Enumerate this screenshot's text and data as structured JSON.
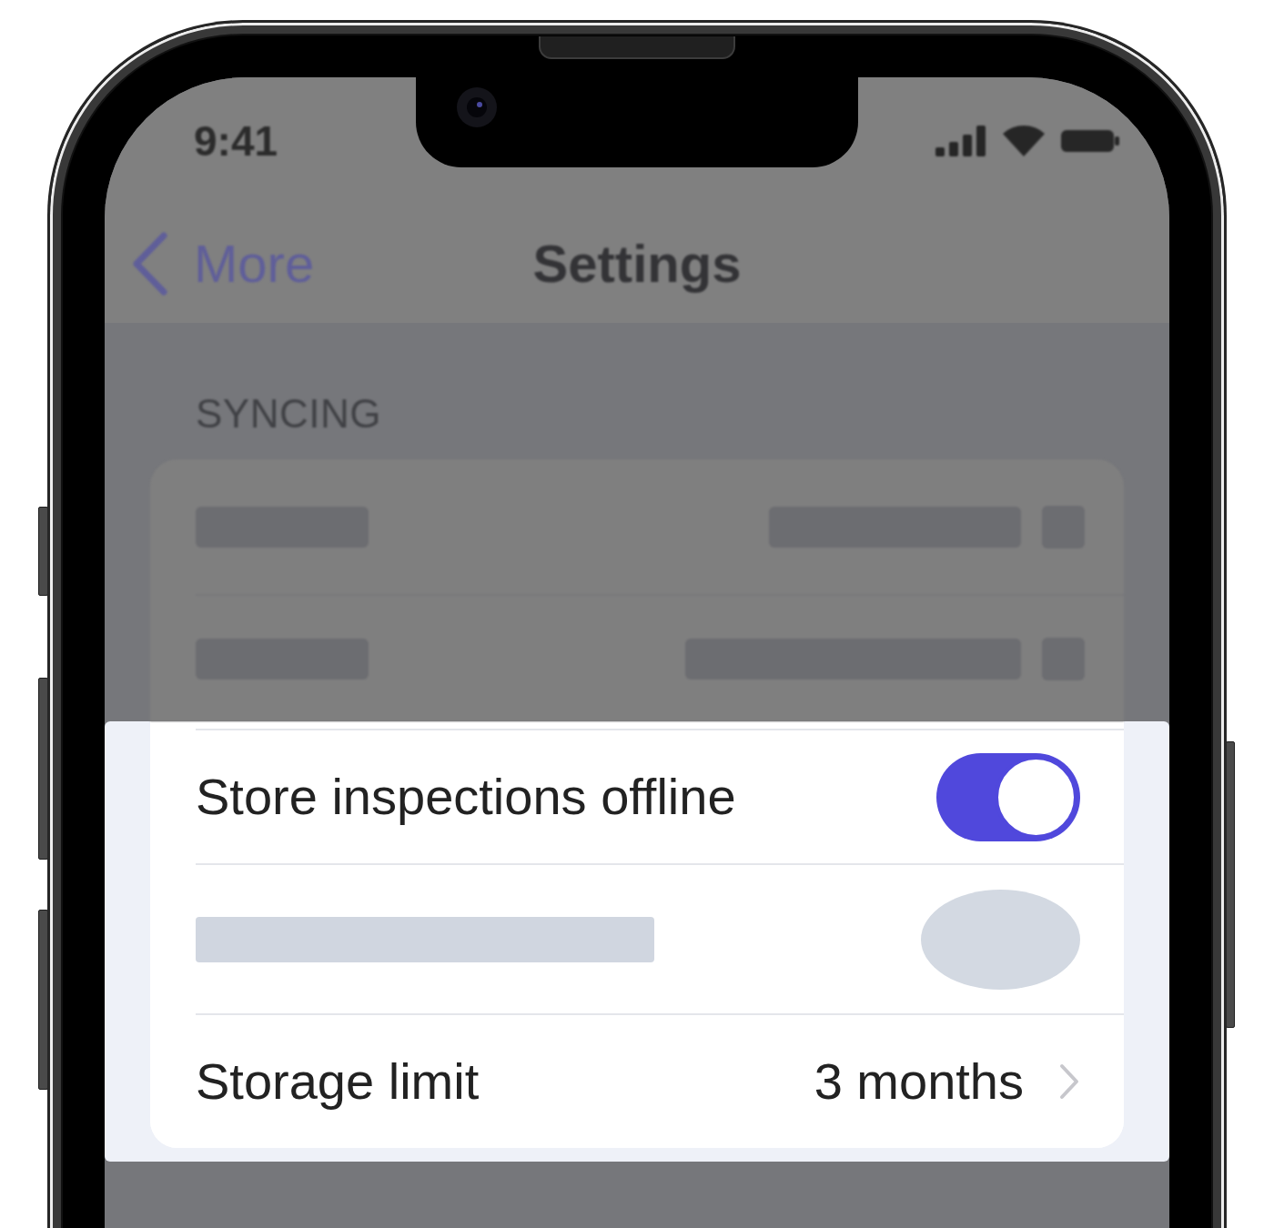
{
  "status_bar": {
    "time": "9:41"
  },
  "nav_bar": {
    "back_label": "More",
    "title": "Settings"
  },
  "section": {
    "header": "SYNCING",
    "rows": [
      {
        "kind": "skeleton",
        "switch": false,
        "highlighted": false
      },
      {
        "kind": "skeleton",
        "switch": false,
        "highlighted": false
      },
      {
        "kind": "toggle",
        "label": "Store inspections offline",
        "on": true,
        "highlighted": true
      },
      {
        "kind": "skeleton",
        "switch": true,
        "highlighted": true
      },
      {
        "kind": "disclosure",
        "label": "Storage limit",
        "value": "3 months",
        "highlighted": true
      }
    ]
  }
}
